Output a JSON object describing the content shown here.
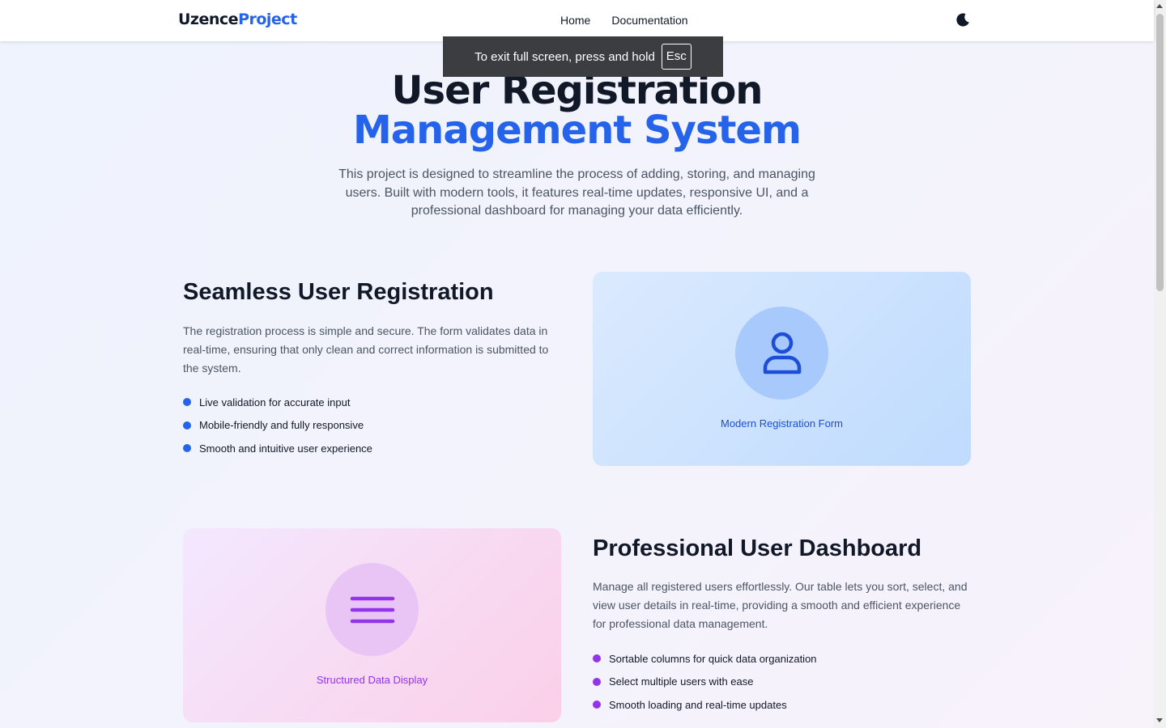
{
  "navbar": {
    "logo_part1": "Uzence",
    "logo_part2": "Project",
    "links": [
      "Home",
      "Documentation"
    ],
    "theme_icon": "moon-icon"
  },
  "toast": {
    "text": "To exit full screen, press and hold",
    "key": "Esc"
  },
  "hero": {
    "title_line1": "User Registration",
    "title_line2": "Management System",
    "description": "This project is designed to streamline the process of adding, storing, and managing users. Built with modern tools, it features real-time updates, responsive UI, and a professional dashboard for managing your data efficiently."
  },
  "registration": {
    "title": "Seamless User Registration",
    "description": "The registration process is simple and secure. The form validates data in real-time, ensuring that only clean and correct information is submitted to the system.",
    "features": [
      "Live validation for accurate input",
      "Mobile-friendly and fully responsive",
      "Smooth and intuitive user experience"
    ],
    "card_caption": "Modern Registration Form",
    "card_icon": "user-icon",
    "accent": "#2563eb"
  },
  "dashboard": {
    "title": "Professional User Dashboard",
    "description": "Manage all registered users effortlessly. Our table lets you sort, select, and view user details in real-time, providing a smooth and efficient experience for professional data management.",
    "features": [
      "Sortable columns for quick data organization",
      "Select multiple users with ease",
      "Smooth loading and real-time updates"
    ],
    "card_caption": "Structured Data Display",
    "card_icon": "menu-lines-icon",
    "accent": "#9333ea"
  }
}
